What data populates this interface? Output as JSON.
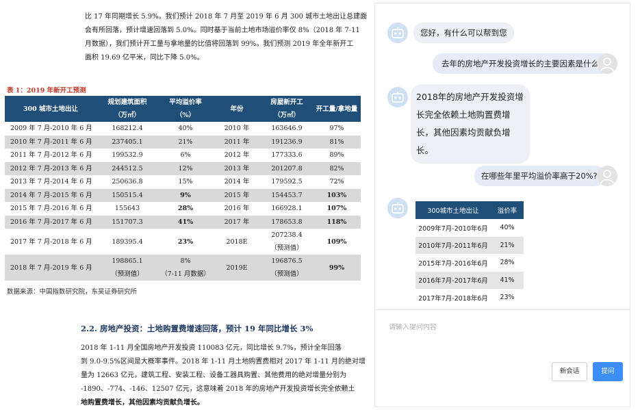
{
  "doc": {
    "para1": [
      "比 17 年同期增长 5.9%。我们预计 2018 年 7 月至 2019 年 6 月 300 城市土地出让总建面",
      "会有所回落，预计增速回落到 5.0%。同时基于当前土地市场溢价率仅 8%（2018 年 7-11",
      "月数据），我们预计开工量与拿地量的比值将回落到 99%。我们预测 2019 年全年新开工",
      "面积 19.69 亿平米，同比下降 5.0%。"
    ],
    "table_caption": "表 1：2019 年新开工预测",
    "table": {
      "headers": [
        [
          "300 城市土地出让"
        ],
        [
          "规划建筑面积",
          "（万㎡）"
        ],
        [
          "平均溢价率",
          "（%）"
        ],
        [
          "年份"
        ],
        [
          "房屋新开工",
          "（万㎡）"
        ],
        [
          "开工量/拿地量"
        ]
      ],
      "rows": [
        [
          [
            "2009 年 7 月-2010 年 6 月"
          ],
          [
            "168212.4"
          ],
          [
            "40%"
          ],
          [
            "2010 年"
          ],
          [
            "163646.9"
          ],
          [
            "97%"
          ]
        ],
        [
          [
            "2010 年 7 月-2011 年 6 月"
          ],
          [
            "237405.1"
          ],
          [
            "21%"
          ],
          [
            "2011 年"
          ],
          [
            "191236.9"
          ],
          [
            "81%"
          ]
        ],
        [
          [
            "2011 年 7 月-2012 年 6 月"
          ],
          [
            "199532.9"
          ],
          [
            "6%"
          ],
          [
            "2012 年"
          ],
          [
            "177333.6"
          ],
          [
            "89%"
          ]
        ],
        [
          [
            "2012 年 7 月-2013 年 6 月"
          ],
          [
            "244512.5"
          ],
          [
            "12%"
          ],
          [
            "2013 年"
          ],
          [
            "201207.8"
          ],
          [
            "82%"
          ]
        ],
        [
          [
            "2013 年 7 月-2014 年 6 月"
          ],
          [
            "250636.8"
          ],
          [
            "15%"
          ],
          [
            "2014 年"
          ],
          [
            "179592.5"
          ],
          [
            "72%"
          ]
        ],
        [
          [
            "2014 年 7 月-2015 年 6 月"
          ],
          [
            "150515.4"
          ],
          [
            "9%"
          ],
          [
            "2015 年"
          ],
          [
            "154453.7"
          ],
          [
            "103%"
          ]
        ],
        [
          [
            "2015 年 7 月-2016 年 6 月"
          ],
          [
            "155643"
          ],
          [
            "28%"
          ],
          [
            "2016 年"
          ],
          [
            "166928.1"
          ],
          [
            "107%"
          ]
        ],
        [
          [
            "2016 年 7 月-2017 年 6 月"
          ],
          [
            "151707.3"
          ],
          [
            "41%"
          ],
          [
            "2017 年"
          ],
          [
            "178653.8"
          ],
          [
            "118%"
          ]
        ],
        [
          [
            "2017 年 7 月-2018 年 6 月"
          ],
          [
            "189395.4"
          ],
          [
            "23%"
          ],
          [
            "2018E"
          ],
          [
            "207238.4",
            "（预测值）"
          ],
          [
            "109%"
          ]
        ],
        [
          [
            "2018 年 7 月-2019 年 6 月"
          ],
          [
            "198865.1",
            "（预测值）"
          ],
          [
            "8%",
            "（7-11 月数据）"
          ],
          [
            "2019E"
          ],
          [
            "196876.5",
            "（预测值）"
          ],
          [
            "99%"
          ]
        ]
      ],
      "bold_cells": [
        [
          5,
          2
        ],
        [
          5,
          5
        ],
        [
          6,
          2
        ],
        [
          6,
          5
        ],
        [
          7,
          2
        ],
        [
          7,
          5
        ],
        [
          8,
          2
        ],
        [
          8,
          5
        ],
        [
          9,
          5
        ]
      ],
      "alt_rows": [
        1,
        3,
        5,
        7,
        9
      ]
    },
    "source": "数据来源：中国指数研究院，东吴证券研究所",
    "section_title": "2.2.  房地产投资：土地购置费增速回落，预计 19 年同比增长 3%",
    "para2": [
      "2018 年 1-11 月全国房地产开发投资 110083 亿元，同比增长 9.7%，预计全年回落",
      "到 9.0-9.5%区间是大概率事件。2018 年 1-11 月土地购置费相对 2017 年 1-11 月的绝对增",
      "量为 12663 亿元，建筑工程、安装工程、设备工器具购置、其他费用的绝对增量分别为",
      "-1890、-774、-146、12507 亿元，这意味着 2018 年的房地产开发投资增长完全依赖土",
      "地购置费增长，其他因素均贡献负增长。"
    ]
  },
  "chat": {
    "messages": {
      "bot_greeting": "您好，有什么可以帮到您",
      "user_q1": "去年的房地产开发投资增长的主要因素是什么?",
      "bot_a1": "2018年的房地产开发投资增长完全依赖土地购置费增长，其他因素均贡献负增长。",
      "user_q2": "在哪些年里平均溢价率高于20%?"
    },
    "answer_table": {
      "headers": [
        "300城市土地出让",
        "溢价率"
      ],
      "rows": [
        [
          "2009年7月-2010年6月",
          "40%"
        ],
        [
          "2010年7月-2011年6月",
          "21%"
        ],
        [
          "2015年7月-2016年6月",
          "28%"
        ],
        [
          "2016年7月-2017年6月",
          "41%"
        ],
        [
          "2017年7月-2018年6月",
          "23%"
        ]
      ]
    },
    "input_placeholder": "请输入提问内容",
    "new_chat_label": "新会话",
    "ask_label": "提问",
    "icons": {
      "bot": "robot-icon",
      "user": "user-avatar-icon"
    },
    "colors": {
      "header_blue": "#1f4e79",
      "primary_button": "#3d8ef7",
      "bot_avatar_bg": "#cfe0f4"
    }
  }
}
